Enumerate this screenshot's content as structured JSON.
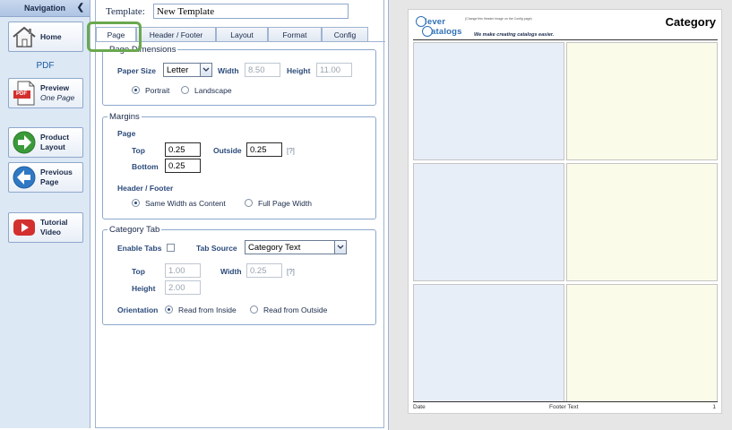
{
  "nav": {
    "header": "Navigation",
    "collapse_glyph": "❮",
    "buttons": [
      {
        "id": "home",
        "label": "Home",
        "sub": "",
        "icon": "house-icon"
      },
      {
        "id": "preview",
        "label": "Preview",
        "sub": "One Page",
        "icon": "pdf-icon"
      },
      {
        "id": "product-layout",
        "label": "Product Layout",
        "sub": "",
        "icon": "arrow-right-icon"
      },
      {
        "id": "previous-page",
        "label": "Previous Page",
        "sub": "",
        "icon": "arrow-left-icon"
      },
      {
        "id": "tutorial",
        "label": "Tutorial Video",
        "sub": "",
        "icon": "play-icon"
      }
    ],
    "pdf_label": "PDF",
    "pdf_icon_text": "PDF"
  },
  "template": {
    "label": "Template:",
    "name": "New Template"
  },
  "tabs": [
    {
      "label": "Page",
      "active": true
    },
    {
      "label": "Header / Footer",
      "active": false
    },
    {
      "label": "Layout",
      "active": false
    },
    {
      "label": "Format",
      "active": false
    },
    {
      "label": "Config",
      "active": false
    }
  ],
  "page_dimensions": {
    "legend": "Page Dimensions",
    "paper_size_label": "Paper Size",
    "paper_size_value": "Letter",
    "width_label": "Width",
    "width_value": "8.50",
    "height_label": "Height",
    "height_value": "11.00",
    "orientation_options": [
      "Portrait",
      "Landscape"
    ],
    "orientation_selected": "Portrait"
  },
  "margins": {
    "legend": "Margins",
    "page_label": "Page",
    "top_label": "Top",
    "top_value": "0.25",
    "outside_label": "Outside",
    "outside_value": "0.25",
    "bottom_label": "Bottom",
    "bottom_value": "0.25",
    "help": "[?]",
    "header_footer_label": "Header / Footer",
    "hf_options": [
      "Same Width as Content",
      "Full Page Width"
    ],
    "hf_selected": "Same Width as Content"
  },
  "category_tab": {
    "legend": "Category Tab",
    "enable_label": "Enable Tabs",
    "enabled": false,
    "source_label": "Tab Source",
    "source_value": "Category Text",
    "top_label": "Top",
    "top_value": "1.00",
    "width_label": "Width",
    "width_value": "0.25",
    "help": "[?]",
    "height_label": "Height",
    "height_value": "2.00",
    "orientation_label": "Orientation",
    "orientation_options": [
      "Read from Inside",
      "Read from Outside"
    ],
    "orientation_selected": "Read from Inside"
  },
  "preview": {
    "logo_top": "lever",
    "logo_bottom": "atalogs",
    "logo_note": "(Change this Header Image on the Config page)",
    "tagline": "We make creating catalogs easier.",
    "title": "Category",
    "footer_left": "Date",
    "footer_center": "Footer Text",
    "footer_right": "1",
    "colors": {
      "blue_cell": "#e8eef7",
      "yellow_cell": "#fbfbea",
      "logo": "#2f6fb6"
    }
  },
  "colors": {
    "highlight": "#6aa84f",
    "nav_bg": "#dde8f5",
    "border": "#9fb4d0",
    "label": "#2b4a7a"
  }
}
